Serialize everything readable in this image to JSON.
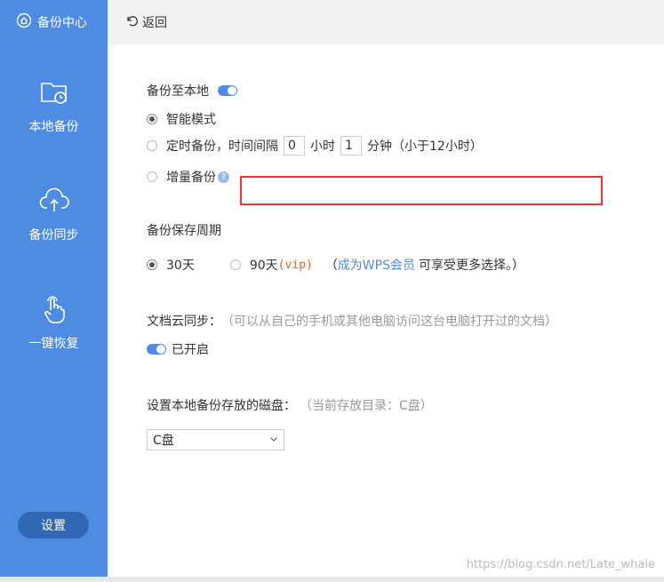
{
  "sidebar": {
    "brand": "备份中心",
    "items": [
      {
        "label": "本地备份"
      },
      {
        "label": "备份同步"
      },
      {
        "label": "一键恢复"
      }
    ],
    "settings_label": "设置"
  },
  "topbar": {
    "back_label": "返回"
  },
  "local_backup": {
    "title": "备份至本地",
    "smart_mode": "智能模式",
    "timed_backup_prefix": "定时备份，时间间隔",
    "hours_value": "0",
    "hours_unit": "小时",
    "minutes_value": "1",
    "minutes_unit": "分钟（小于12小时）",
    "incremental": "增量备份",
    "help_glyph": "?"
  },
  "retention": {
    "title": "备份保存周期",
    "opt30": "30天",
    "opt90": "90天",
    "vip": "(vip)",
    "paren_open": "（",
    "member_link": "成为WPS会员",
    "member_suffix": "可享受更多选择。）"
  },
  "cloud_sync": {
    "title": "文档云同步：",
    "hint": "（可以从自己的手机或其他电脑访问这台电脑打开过的文档）",
    "status": "已开启"
  },
  "disk": {
    "title": "设置本地备份存放的磁盘：",
    "hint": "（当前存放目录：C盘）",
    "selected": "C盘"
  },
  "watermark": "https://blog.csdn.net/Late_whale",
  "colors": {
    "accent": "#4e8ce3",
    "highlight_border": "#ee3333",
    "vip": "#e0622b"
  }
}
